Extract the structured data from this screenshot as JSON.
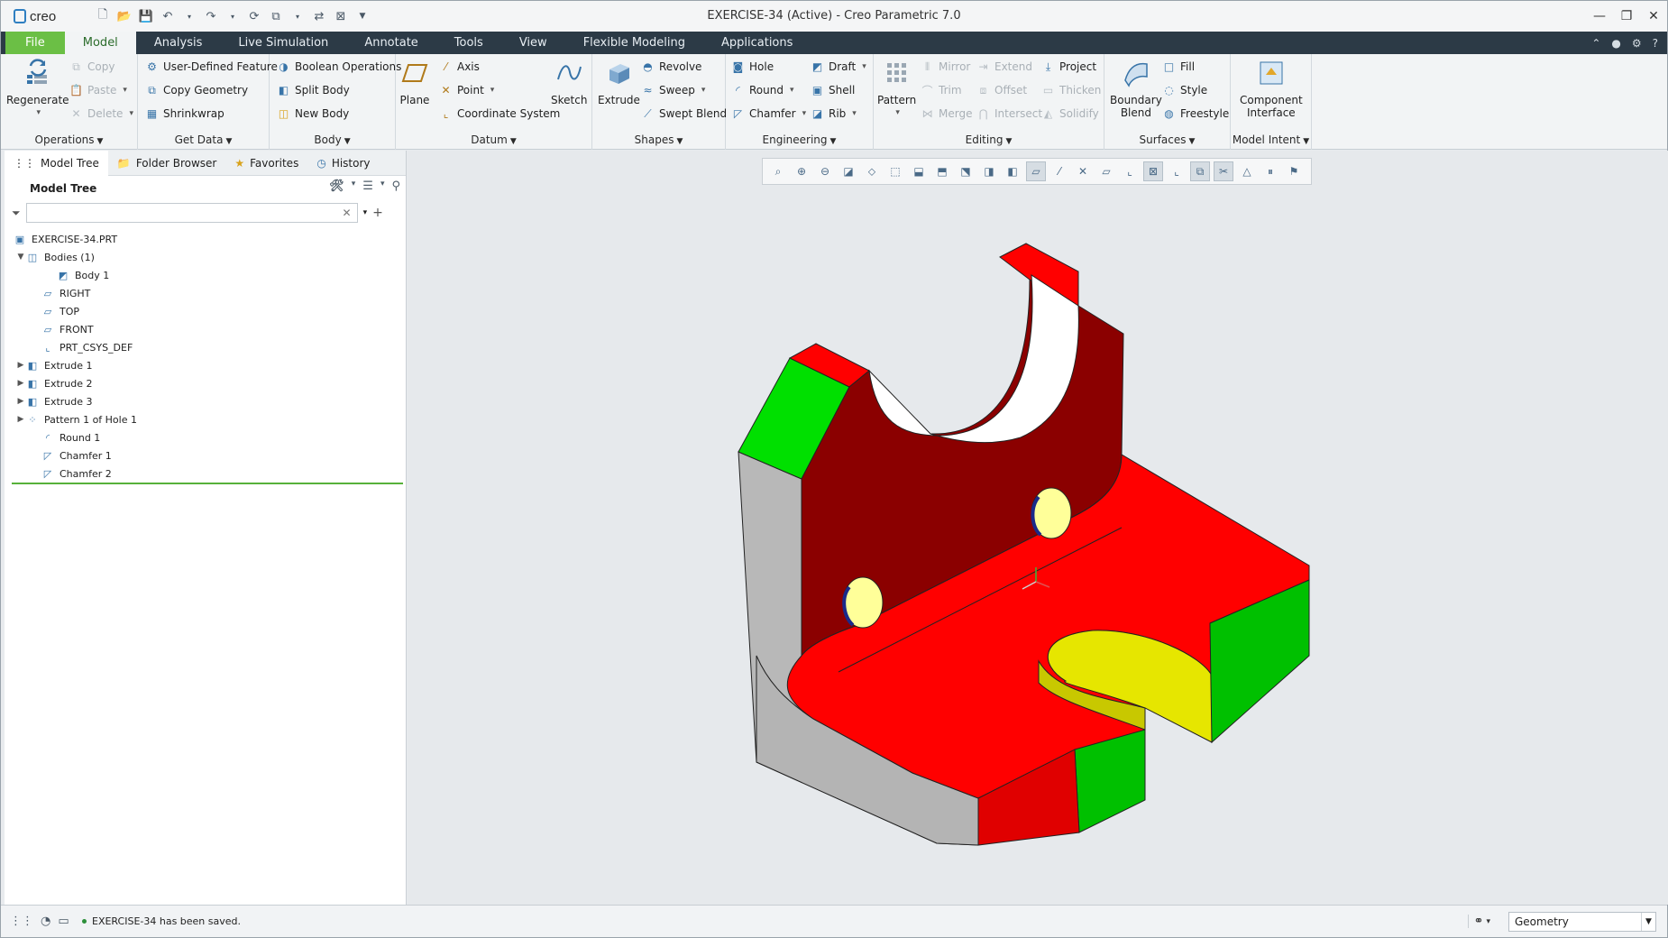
{
  "app": {
    "logo_text": "creo",
    "window_title": "EXERCISE-34 (Active) - Creo Parametric 7.0"
  },
  "tabs": [
    {
      "label": "File"
    },
    {
      "label": "Model"
    },
    {
      "label": "Analysis"
    },
    {
      "label": "Live Simulation"
    },
    {
      "label": "Annotate"
    },
    {
      "label": "Tools"
    },
    {
      "label": "View"
    },
    {
      "label": "Flexible Modeling"
    },
    {
      "label": "Applications"
    }
  ],
  "ribbon": {
    "operations": {
      "label": "Operations",
      "regenerate": "Regenerate",
      "copy": "Copy",
      "paste": "Paste",
      "delete": "Delete"
    },
    "get_data": {
      "label": "Get Data",
      "udf": "User-Defined Feature",
      "copy_geometry": "Copy Geometry",
      "shrinkwrap": "Shrinkwrap"
    },
    "body": {
      "label": "Body",
      "boolean": "Boolean Operations",
      "split": "Split Body",
      "new": "New Body"
    },
    "datum": {
      "label": "Datum",
      "plane": "Plane",
      "axis": "Axis",
      "point": "Point",
      "csys": "Coordinate System",
      "sketch": "Sketch"
    },
    "shapes": {
      "label": "Shapes",
      "extrude": "Extrude",
      "revolve": "Revolve",
      "sweep": "Sweep",
      "swept_blend": "Swept Blend"
    },
    "engineering": {
      "label": "Engineering",
      "hole": "Hole",
      "round": "Round",
      "chamfer": "Chamfer",
      "draft": "Draft",
      "shell": "Shell",
      "rib": "Rib"
    },
    "editing": {
      "label": "Editing",
      "pattern": "Pattern",
      "mirror": "Mirror",
      "trim": "Trim",
      "merge": "Merge",
      "extend": "Extend",
      "offset": "Offset",
      "intersect": "Intersect",
      "project": "Project",
      "thicken": "Thicken",
      "solidify": "Solidify"
    },
    "surfaces": {
      "label": "Surfaces",
      "boundary_blend_1": "Boundary",
      "boundary_blend_2": "Blend",
      "fill": "Fill",
      "style": "Style",
      "freestyle": "Freestyle"
    },
    "model_intent": {
      "label": "Model Intent",
      "component_1": "Component",
      "component_2": "Interface"
    }
  },
  "navigator": {
    "tabs": [
      "Model Tree",
      "Folder Browser",
      "Favorites",
      "History"
    ],
    "tree_title": "Model Tree",
    "filter_placeholder": "",
    "items": [
      {
        "label": "EXERCISE-34.PRT",
        "icon": "part-icon"
      },
      {
        "label": "Bodies (1)",
        "icon": "bodies-icon"
      },
      {
        "label": "Body 1",
        "icon": "body-icon"
      },
      {
        "label": "RIGHT",
        "icon": "datum-plane-icon"
      },
      {
        "label": "TOP",
        "icon": "datum-plane-icon"
      },
      {
        "label": "FRONT",
        "icon": "datum-plane-icon"
      },
      {
        "label": "PRT_CSYS_DEF",
        "icon": "csys-icon"
      },
      {
        "label": "Extrude 1",
        "icon": "extrude-icon"
      },
      {
        "label": "Extrude 2",
        "icon": "extrude-icon"
      },
      {
        "label": "Extrude 3",
        "icon": "extrude-icon"
      },
      {
        "label": "Pattern 1 of Hole 1",
        "icon": "pattern-icon"
      },
      {
        "label": "Round 1",
        "icon": "round-icon"
      },
      {
        "label": "Chamfer 1",
        "icon": "chamfer-icon"
      },
      {
        "label": "Chamfer 2",
        "icon": "chamfer-icon"
      }
    ]
  },
  "status": {
    "message": "EXERCISE-34 has been saved.",
    "selection_filter": "Geometry"
  },
  "colors": {
    "file_tab": "#6bbf45",
    "tab_bar": "#2c3a46",
    "face_red": "#ff0000",
    "face_darkred": "#8b0000",
    "face_green": "#00c800",
    "face_yellow": "#e6e600",
    "face_gray": "#b4b4b4"
  }
}
